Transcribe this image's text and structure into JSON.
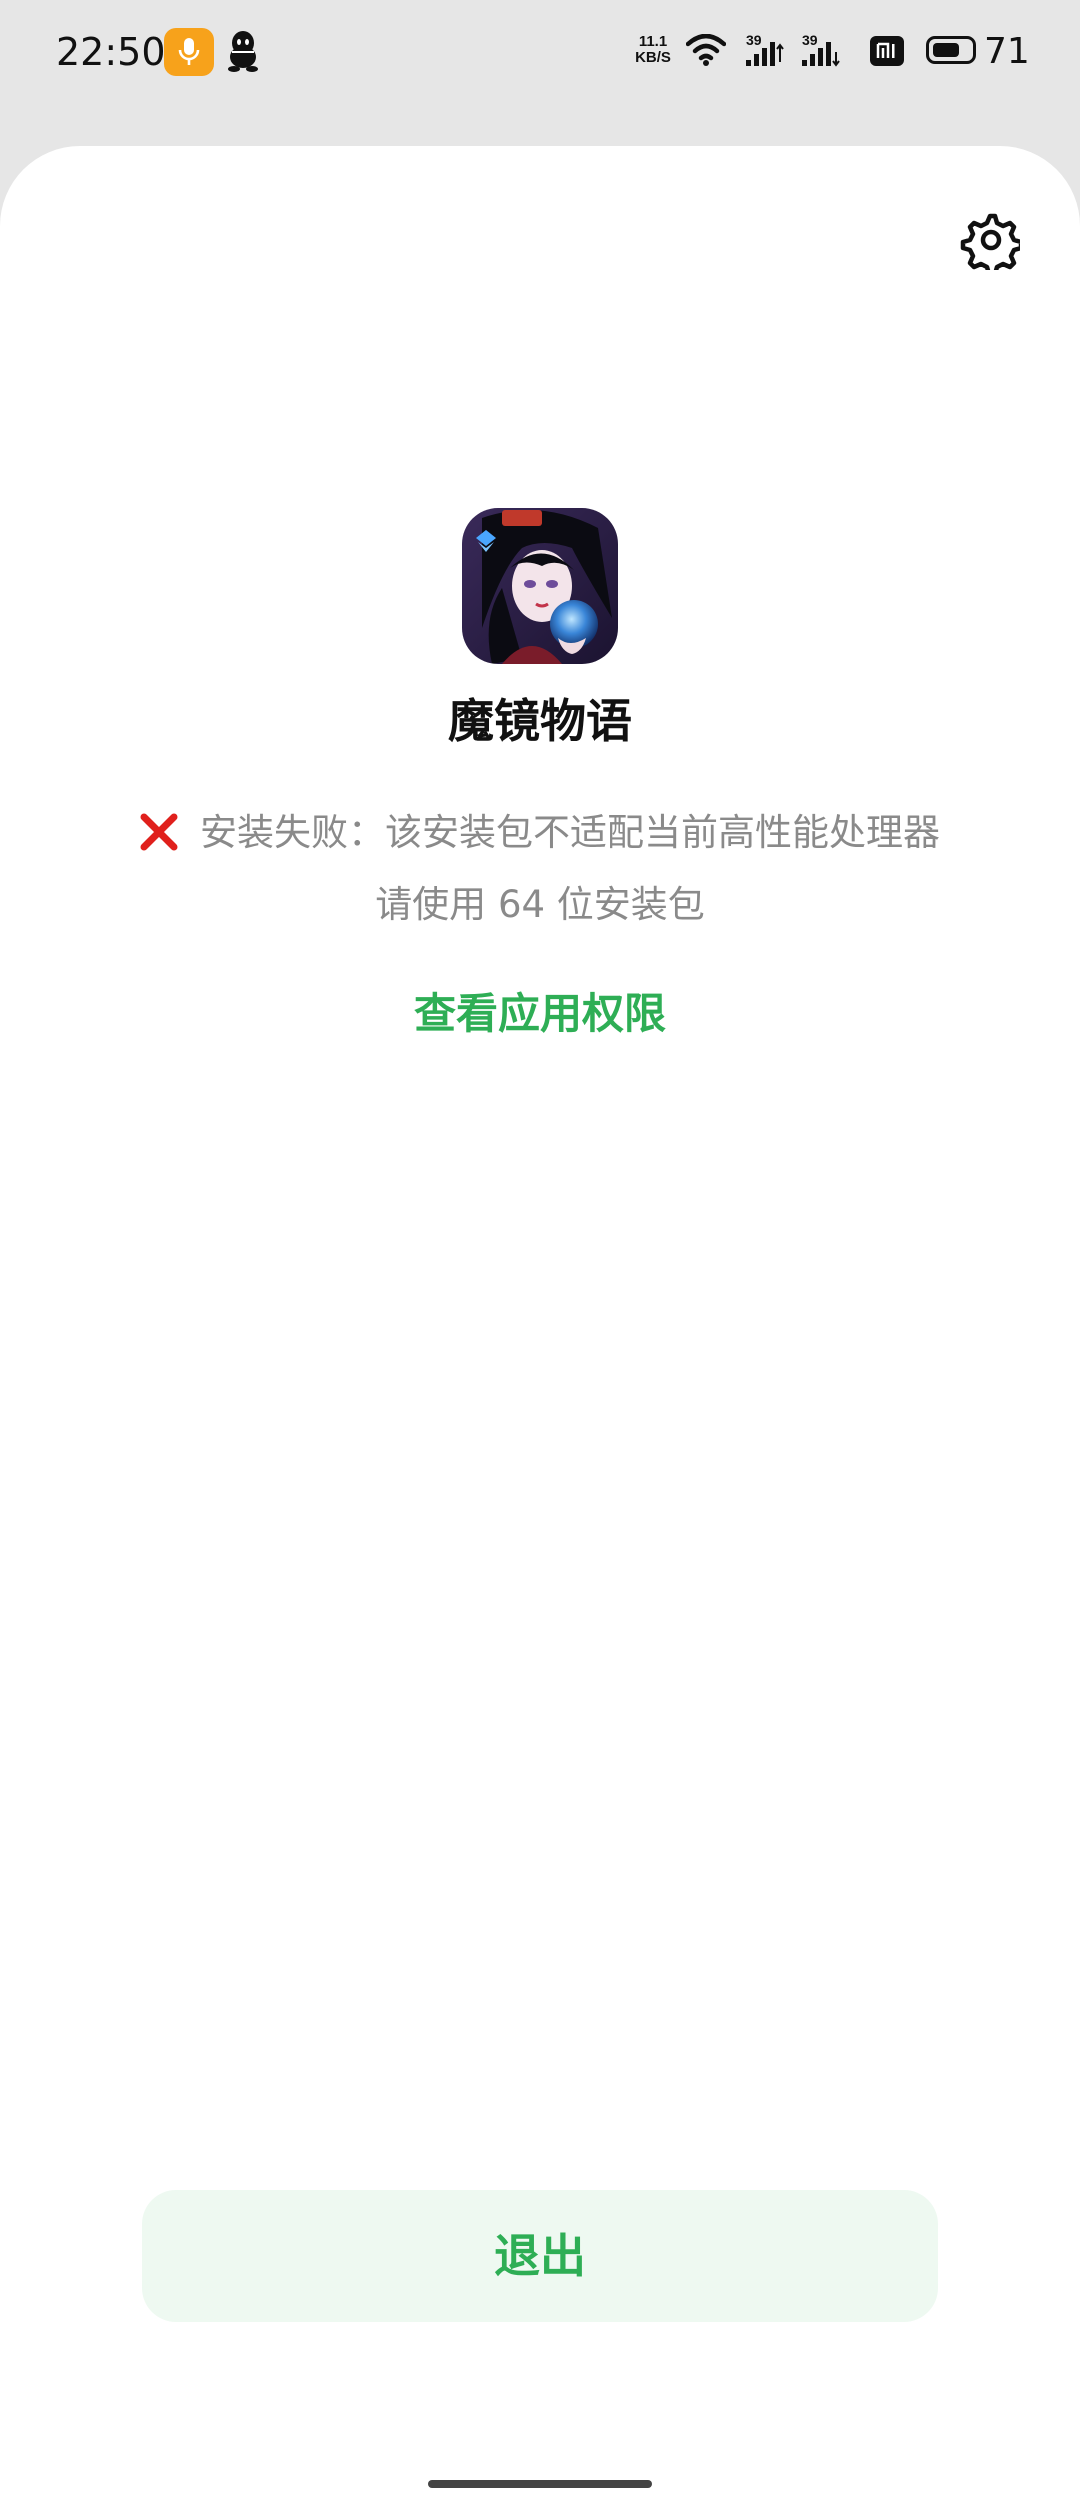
{
  "status_bar": {
    "time": "22:50",
    "net_speed_value": "11.1",
    "net_speed_unit": "KB/S",
    "signal_1_label": "39",
    "signal_2_label": "39",
    "battery_level": 71,
    "battery_text": "71",
    "icons": [
      "mic-icon",
      "qq-icon",
      "wifi-icon",
      "signal-icon",
      "signal-icon",
      "mi-icon",
      "battery-icon"
    ],
    "mic_badge_color": "#f7a21b"
  },
  "installer": {
    "settings_icon": "gear-icon",
    "app_name": "魔镜物语",
    "error_icon": "red-x-icon",
    "error_line_1": "安装失败：该安装包不适配当前高性能处理器",
    "error_line_2": "请使用 64 位安装包",
    "permissions_link": "查看应用权限",
    "exit_button": "退出"
  },
  "colors": {
    "accent_green": "#2eae55",
    "exit_button_bg": "#eef9f1",
    "error_red": "#e0201c",
    "error_text": "#8a8a8a"
  }
}
